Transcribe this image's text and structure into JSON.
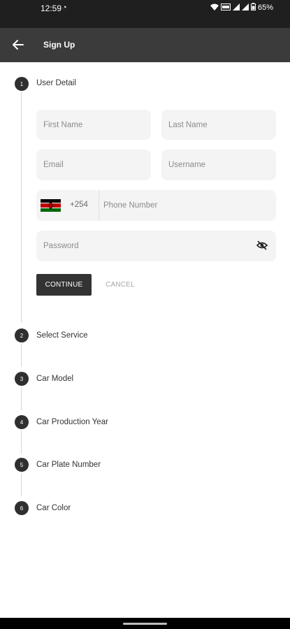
{
  "status_bar": {
    "time": "12:59",
    "battery": "65%"
  },
  "app_bar": {
    "title": "Sign Up"
  },
  "steps": [
    {
      "number": "1",
      "label": "User Detail"
    },
    {
      "number": "2",
      "label": "Select Service"
    },
    {
      "number": "3",
      "label": "Car Model"
    },
    {
      "number": "4",
      "label": "Car Production Year"
    },
    {
      "number": "5",
      "label": "Car Plate Number"
    },
    {
      "number": "6",
      "label": "Car Color"
    }
  ],
  "form": {
    "first_name_placeholder": "First Name",
    "last_name_placeholder": "Last Name",
    "email_placeholder": "Email",
    "username_placeholder": "Username",
    "dial_code": "+254",
    "phone_placeholder": "Phone Number",
    "password_placeholder": "Password"
  },
  "buttons": {
    "continue": "CONTINUE",
    "cancel": "CANCEL"
  },
  "icons": {
    "back": "arrow-left-icon",
    "password_toggle": "eye-off-icon",
    "flag": "kenya-flag-icon"
  },
  "colors": {
    "app_bar": "#3b3b3b",
    "status_bar": "#1f1f1f",
    "step_marker": "#2f2f2f",
    "primary_button": "#333333",
    "field_bg": "#f4f4f4"
  }
}
